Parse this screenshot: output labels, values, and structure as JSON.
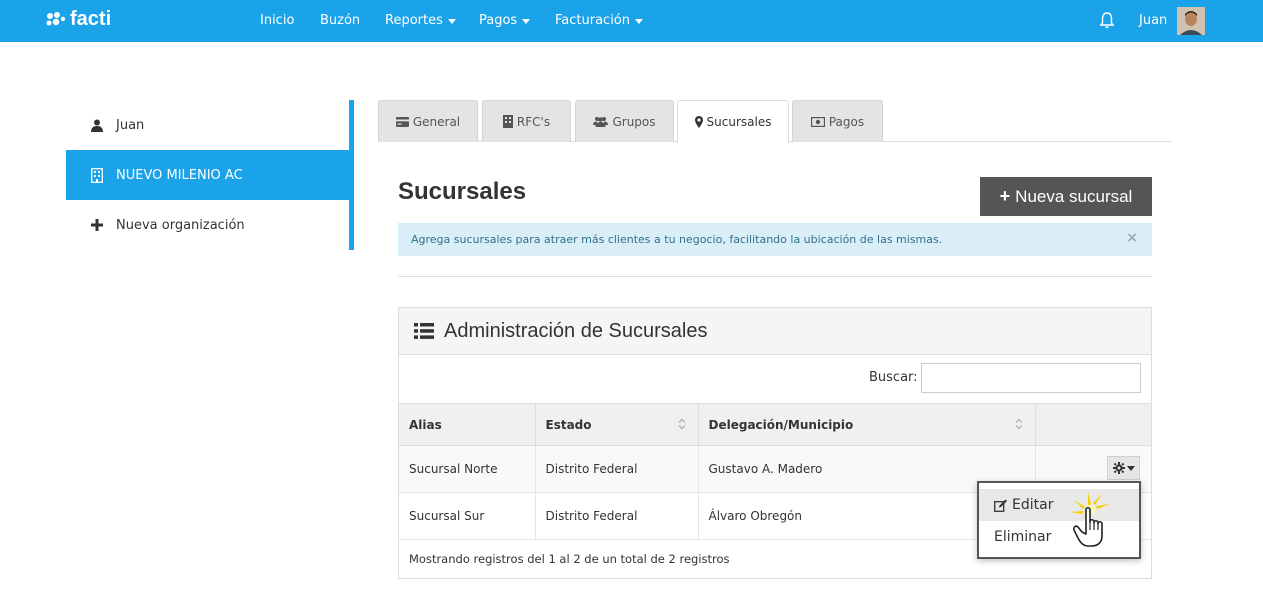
{
  "brand": {
    "name": "facti",
    "color": "#1aa3e9"
  },
  "nav": {
    "items": [
      {
        "label": "Inicio",
        "dropdown": false
      },
      {
        "label": "Buzón",
        "dropdown": false
      },
      {
        "label": "Reportes",
        "dropdown": true
      },
      {
        "label": "Pagos",
        "dropdown": true
      },
      {
        "label": "Facturación",
        "dropdown": true
      }
    ],
    "user": "Juan",
    "icons": {
      "notifications": "bell-icon",
      "avatar": "user-photo"
    }
  },
  "sidebar": {
    "items": [
      {
        "label": "Juan",
        "icon": "user-icon",
        "active": false
      },
      {
        "label": "NUEVO MILENIO AC",
        "icon": "building-icon",
        "active": true
      },
      {
        "label": "Nueva organización",
        "icon": "plus-icon",
        "active": false
      }
    ]
  },
  "tabs": [
    {
      "label": "General",
      "icon": "credit-card-icon",
      "active": false
    },
    {
      "label": "RFC's",
      "icon": "building-icon",
      "active": false
    },
    {
      "label": "Grupos",
      "icon": "users-icon",
      "active": false
    },
    {
      "label": "Sucursales",
      "icon": "map-marker-icon",
      "active": true
    },
    {
      "label": "Pagos",
      "icon": "money-icon",
      "active": false
    }
  ],
  "main": {
    "title": "Sucursales",
    "new_button": "Nueva sucursal",
    "alert": "Agrega sucursales para atraer más clientes a tu negocio, facilitando la ubicación de las mismas.",
    "alert_close": "×"
  },
  "panel": {
    "title": "Administración de Sucursales",
    "search_label": "Buscar:",
    "search_value": "",
    "columns": [
      "Alias",
      "Estado",
      "Delegación/Municipio",
      ""
    ],
    "rows": [
      {
        "alias": "Sucursal Norte",
        "estado": "Distrito Federal",
        "delegacion": "Gustavo A. Madero"
      },
      {
        "alias": "Sucursal Sur",
        "estado": "Distrito Federal",
        "delegacion": "Álvaro Obregón"
      }
    ],
    "footer": "Mostrando registros del 1 al 2 de un total de 2 registros"
  },
  "row_menu": {
    "items": [
      {
        "label": "Editar",
        "icon": "edit-icon",
        "hover": true
      },
      {
        "label": "Eliminar",
        "icon": "",
        "hover": false
      }
    ]
  }
}
